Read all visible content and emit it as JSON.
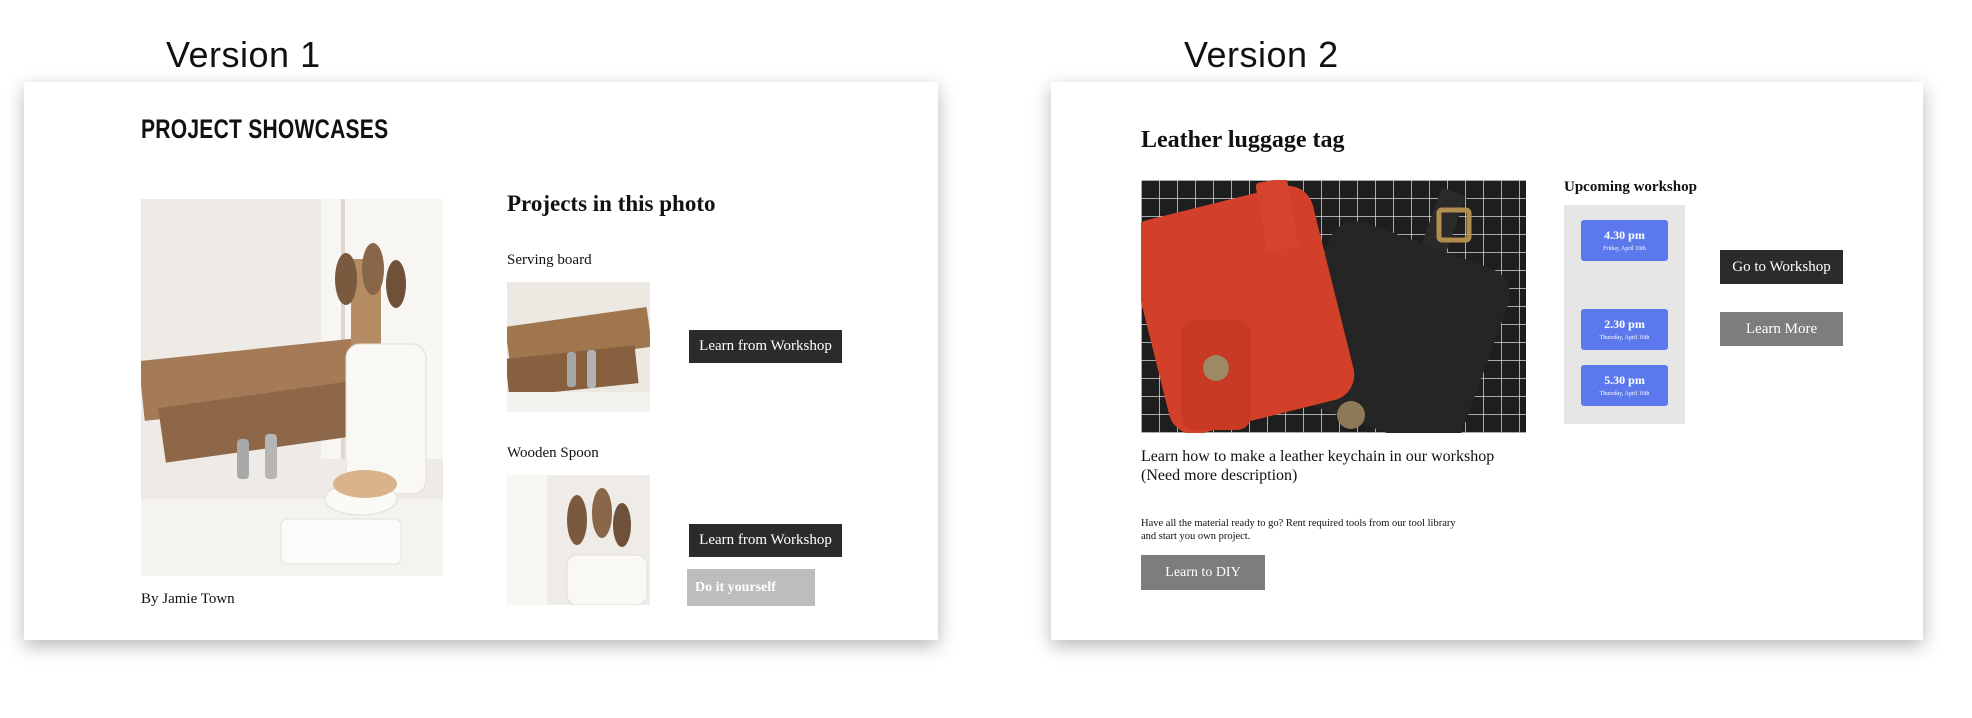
{
  "labels": {
    "version1": "Version 1",
    "version2": "Version 2"
  },
  "v1": {
    "title": "PROJECT SHOWCASES",
    "projects_heading": "Projects in this photo",
    "byline": "By Jamie Town",
    "items": [
      {
        "name": "Serving board",
        "button": "Learn from Workshop"
      },
      {
        "name": "Wooden Spoon",
        "button": "Learn from Workshop",
        "diy": "Do it yourself"
      }
    ]
  },
  "v2": {
    "title": "Leather luggage tag",
    "description": "Learn how to make a leather keychain in our workshop",
    "description_note": "(Need more description)",
    "diy_text_1": "Have all the material ready to go? Rent required tools from our tool library",
    "diy_text_2": "and start you own project.",
    "diy_button": "Learn to DIY",
    "upcoming_heading": "Upcoming workshop",
    "slots": [
      {
        "time": "4.30 pm",
        "date": "Friday, April 10th"
      },
      {
        "time": "2.30 pm",
        "date": "Thursday, April 16th"
      },
      {
        "time": "5.30 pm",
        "date": "Thursday, April 16th"
      }
    ],
    "go_button": "Go to Workshop",
    "more_button": "Learn More"
  },
  "colors": {
    "slot_blue": "#5b79ec",
    "dark_button": "#2b2b2b",
    "gray_button": "#7d7d7d",
    "light_button": "#bdbdbd",
    "panel_gray": "#e6e6e6"
  }
}
